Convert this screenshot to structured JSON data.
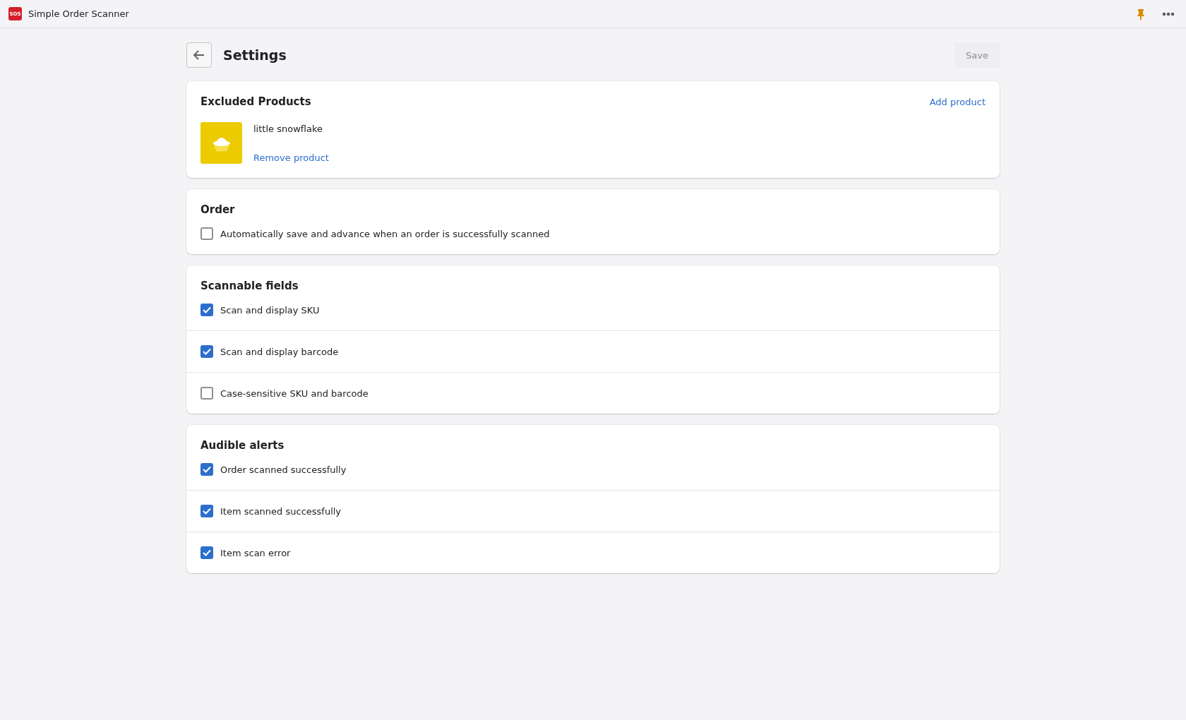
{
  "app_bar": {
    "logo": "SOS",
    "title": "Simple Order Scanner",
    "pinned": true
  },
  "header": {
    "title": "Settings",
    "save": {
      "label": "Save",
      "disabled": true
    }
  },
  "excluded_products": {
    "title": "Excluded Products",
    "add_label": "Add product",
    "products": [
      {
        "name": "little snowflake",
        "remove_label": "Remove product"
      }
    ]
  },
  "sections": [
    {
      "title": "Order",
      "options": [
        {
          "label": "Automatically save and advance when an order is successfully scanned",
          "checked": false
        }
      ]
    },
    {
      "title": "Scannable fields",
      "options": [
        {
          "label": "Scan and display SKU",
          "checked": true
        },
        {
          "label": "Scan and display barcode",
          "checked": true
        },
        {
          "label": "Case-sensitive SKU and barcode",
          "checked": false
        }
      ]
    },
    {
      "title": "Audible alerts",
      "options": [
        {
          "label": "Order scanned successfully",
          "checked": true
        },
        {
          "label": "Item scanned successfully",
          "checked": true
        },
        {
          "label": "Item scan error",
          "checked": true
        }
      ]
    }
  ]
}
